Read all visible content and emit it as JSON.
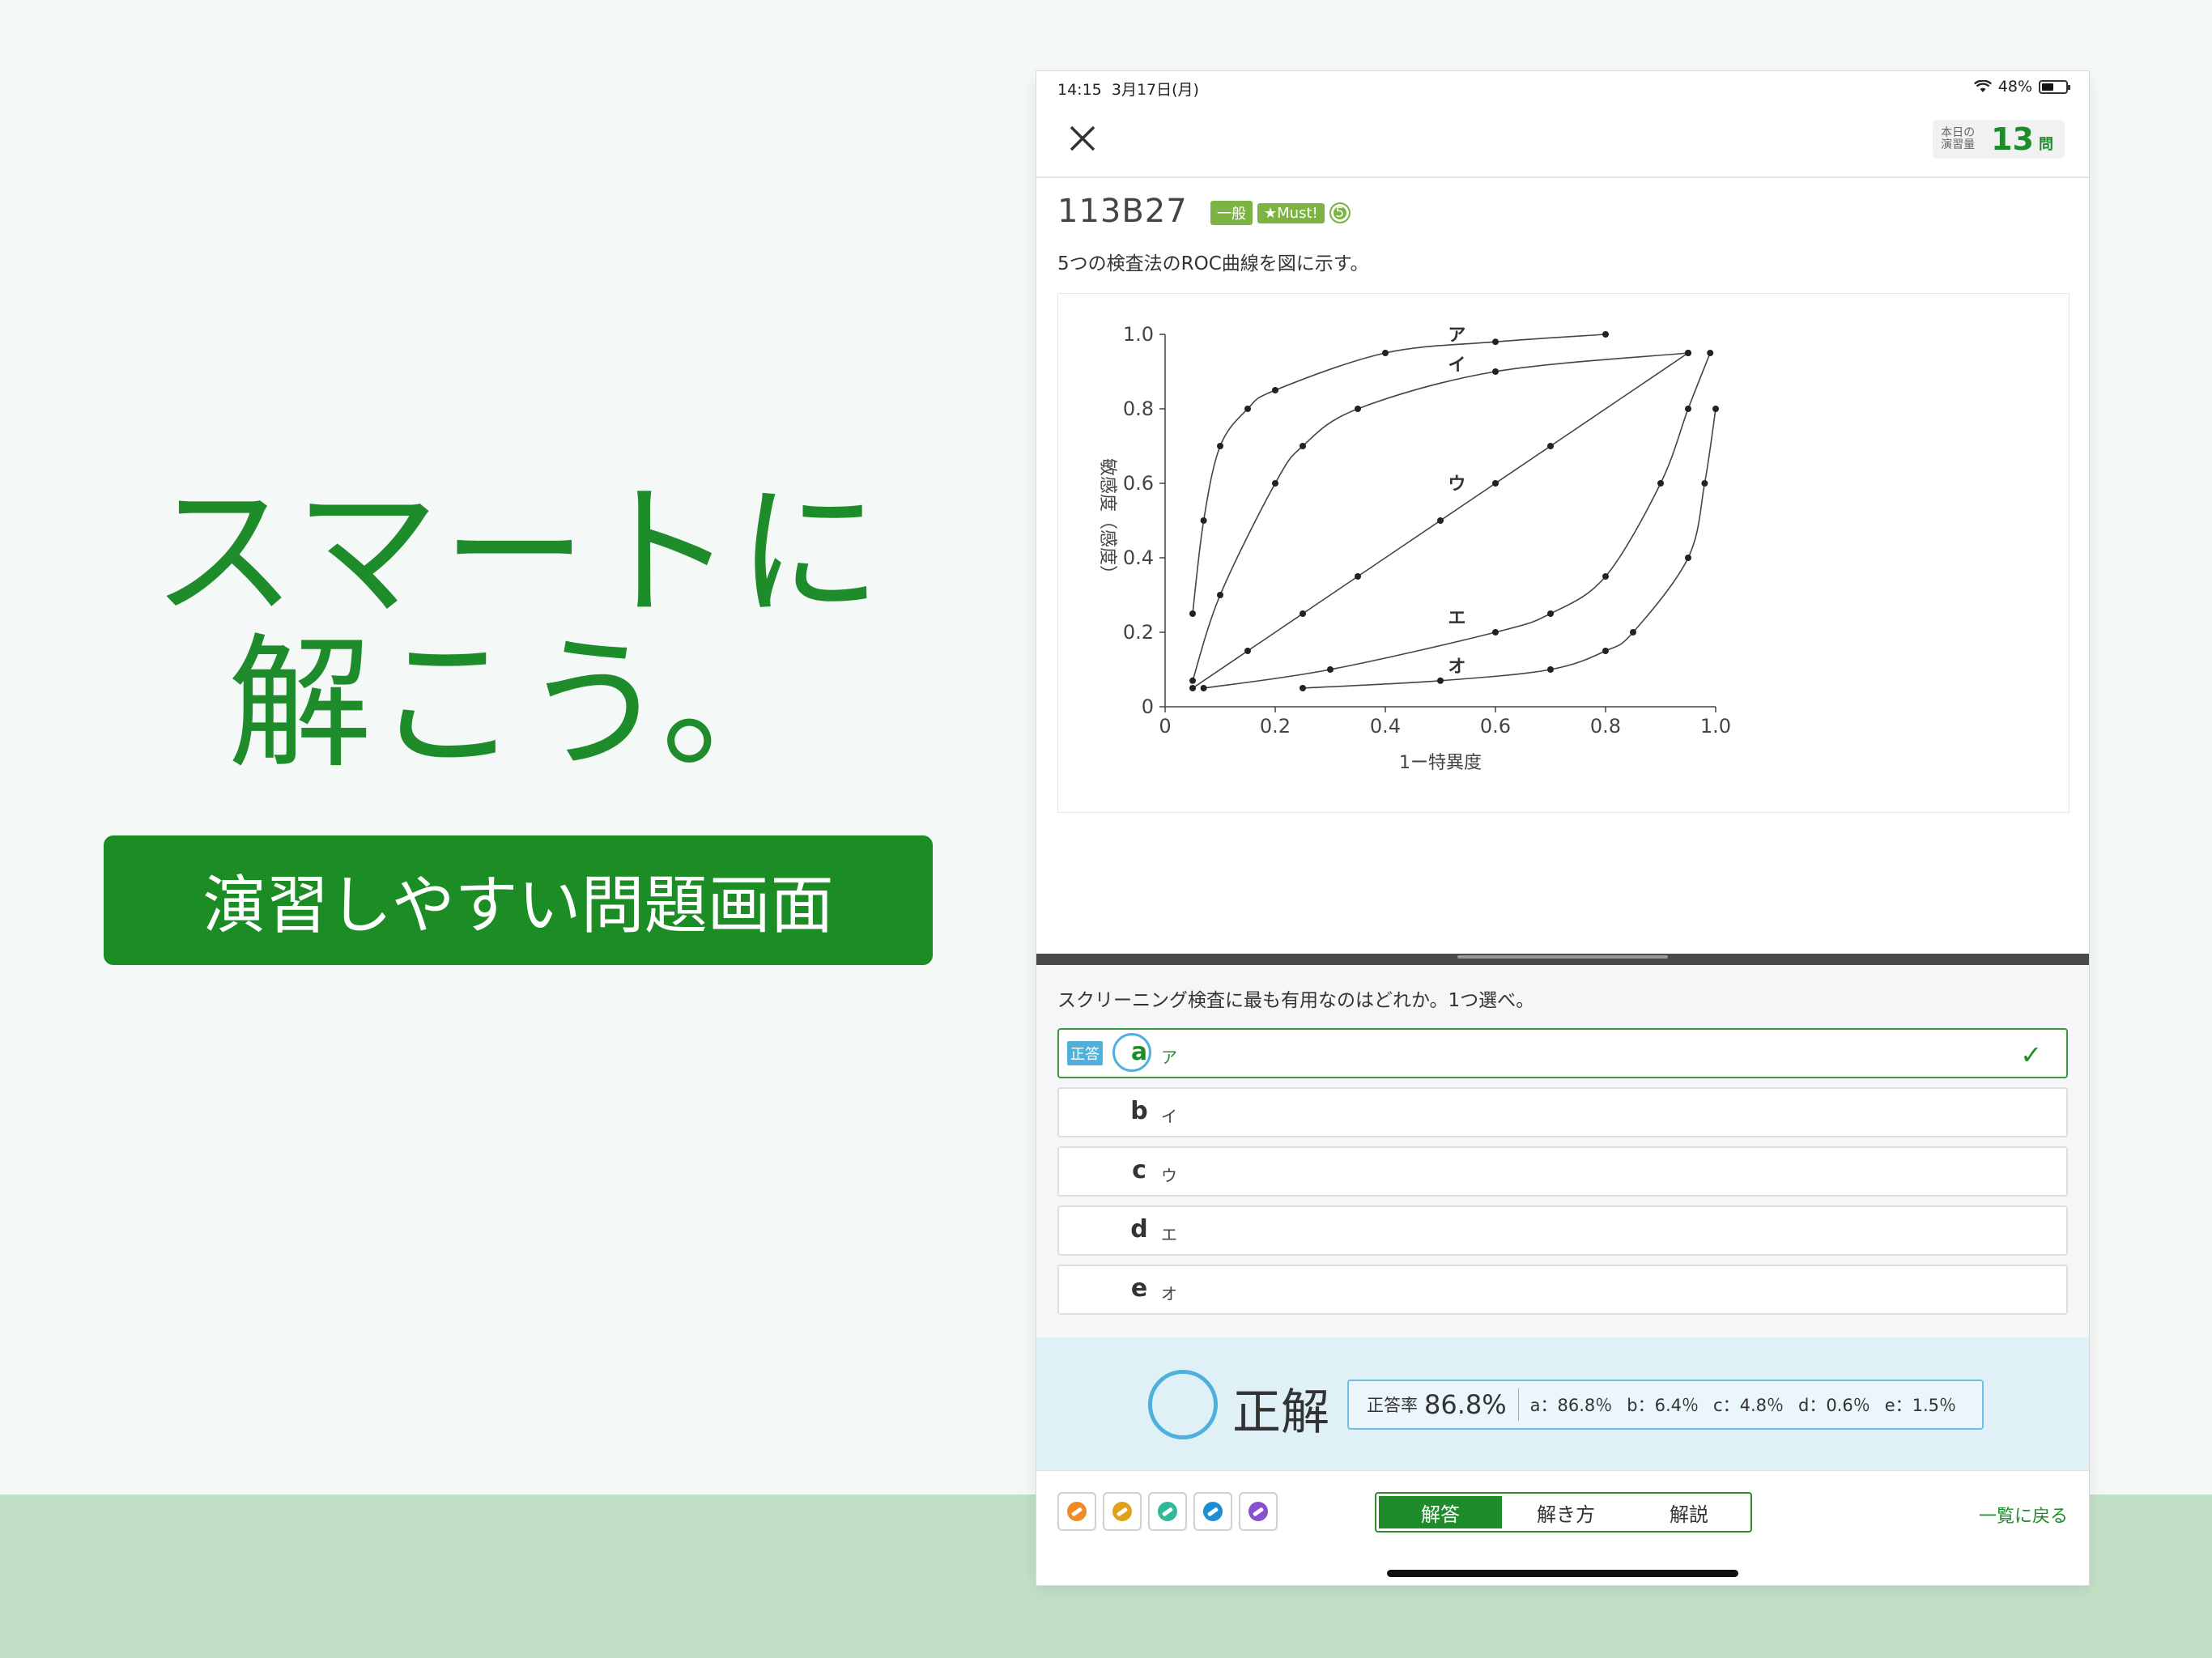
{
  "hero": {
    "line1": "スマートに",
    "line2": "解こう。",
    "button": "演習しやすい問題画面"
  },
  "status": {
    "time": "14:15",
    "date": "3月17日(月)",
    "battery": "48%"
  },
  "nav": {
    "counter_label": "本日の演習量",
    "counter_value": "13",
    "counter_unit": "問"
  },
  "question": {
    "id": "113B27",
    "tags": [
      "一般",
      "★Must!"
    ],
    "tag_number": "5",
    "stem": "5つの検査法のROC曲線を図に示す。",
    "prompt": "スクリーニング検査に最も有用なのはどれか。1つ選べ。"
  },
  "choices": [
    {
      "letter": "a",
      "text": "ア",
      "correct": true
    },
    {
      "letter": "b",
      "text": "イ"
    },
    {
      "letter": "c",
      "text": "ウ"
    },
    {
      "letter": "d",
      "text": "エ"
    },
    {
      "letter": "e",
      "text": "オ"
    }
  ],
  "correct_badge": "正答",
  "result": {
    "label": "正解",
    "rate_label": "正答率",
    "rate_value": "86.8%",
    "distribution": [
      "a：86.8％",
      "b：6.4％",
      "c：4.8％",
      "d：0.6％",
      "e：1.5％"
    ]
  },
  "footer": {
    "tabs": [
      "解答",
      "解き方",
      "解説"
    ],
    "back": "一覧に戻る",
    "pen_colors": [
      "#f08a24",
      "#e0a21a",
      "#2fb89a",
      "#1d8fd0",
      "#8a4fcf"
    ]
  },
  "chart_data": {
    "type": "line",
    "xlabel": "1ー特異度",
    "ylabel": "敏感度（感度）",
    "xlim": [
      0,
      1.0
    ],
    "ylim": [
      0,
      1.0
    ],
    "xticks": [
      "0",
      "0.2",
      "0.4",
      "0.6",
      "0.8",
      "1.0"
    ],
    "yticks": [
      "0",
      "0.2",
      "0.4",
      "0.6",
      "0.8",
      "1.0"
    ],
    "series": [
      {
        "name": "ア",
        "x": [
          0.05,
          0.07,
          0.1,
          0.15,
          0.2,
          0.4,
          0.6,
          0.8
        ],
        "y": [
          0.25,
          0.5,
          0.7,
          0.8,
          0.85,
          0.95,
          0.98,
          1.0
        ]
      },
      {
        "name": "イ",
        "x": [
          0.05,
          0.1,
          0.2,
          0.25,
          0.35,
          0.6,
          0.95
        ],
        "y": [
          0.07,
          0.3,
          0.6,
          0.7,
          0.8,
          0.9,
          0.95
        ]
      },
      {
        "name": "ウ",
        "x": [
          0.05,
          0.15,
          0.25,
          0.35,
          0.5,
          0.6,
          0.7,
          0.95
        ],
        "y": [
          0.05,
          0.15,
          0.25,
          0.35,
          0.5,
          0.6,
          0.7,
          0.95
        ]
      },
      {
        "name": "エ",
        "x": [
          0.07,
          0.3,
          0.6,
          0.7,
          0.8,
          0.9,
          0.95,
          0.99
        ],
        "y": [
          0.05,
          0.1,
          0.2,
          0.25,
          0.35,
          0.6,
          0.8,
          0.95
        ]
      },
      {
        "name": "オ",
        "x": [
          0.25,
          0.5,
          0.7,
          0.8,
          0.85,
          0.95,
          0.98,
          1.0
        ],
        "y": [
          0.05,
          0.07,
          0.1,
          0.15,
          0.2,
          0.4,
          0.6,
          0.8
        ]
      }
    ]
  }
}
